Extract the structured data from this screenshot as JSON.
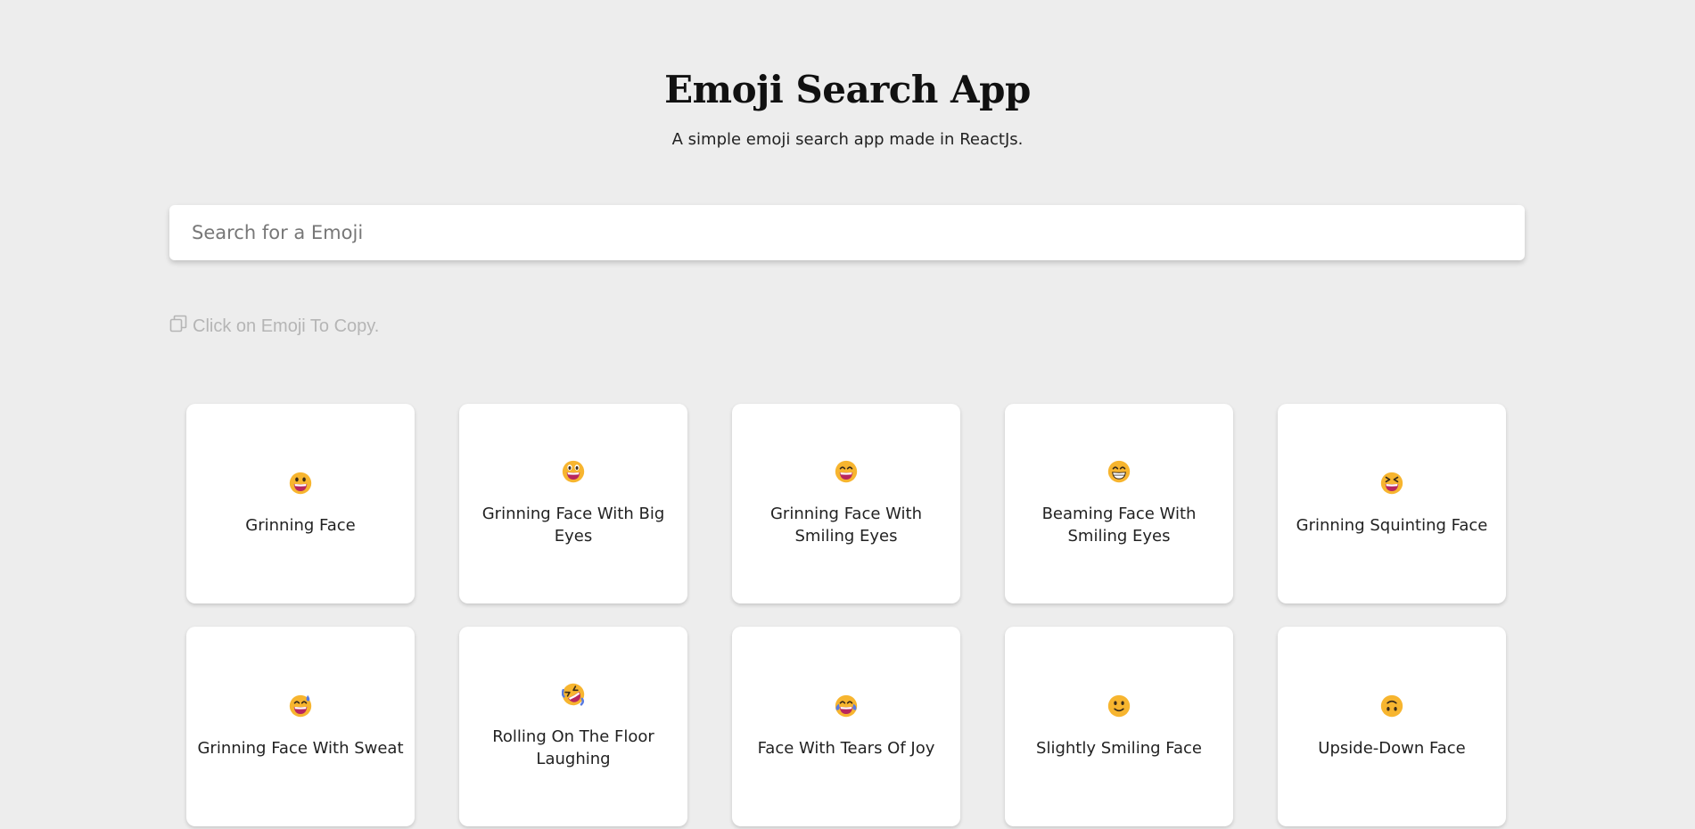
{
  "header": {
    "title": "Emoji Search App",
    "subtitle": "A simple emoji search app made in ReactJs."
  },
  "search": {
    "placeholder": "Search for a Emoji",
    "value": ""
  },
  "hint": {
    "text": "Click on Emoji To Copy.",
    "icon": "copy-icon"
  },
  "colors": {
    "background": "#ededed",
    "card": "#ffffff",
    "emoji_face": "#f7b52f",
    "emoji_mouth": "#b8265e",
    "hint_text": "#b5b5b5"
  },
  "emojis": [
    {
      "name": "Grinning Face",
      "icon": "grinning-face-icon"
    },
    {
      "name": "Grinning Face With Big Eyes",
      "icon": "grinning-face-big-eyes-icon"
    },
    {
      "name": "Grinning Face With Smiling Eyes",
      "icon": "grinning-face-smiling-eyes-icon"
    },
    {
      "name": "Beaming Face With Smiling Eyes",
      "icon": "beaming-face-icon"
    },
    {
      "name": "Grinning Squinting Face",
      "icon": "grinning-squinting-face-icon"
    },
    {
      "name": "Grinning Face With Sweat",
      "icon": "grinning-face-sweat-icon"
    },
    {
      "name": "Rolling On The Floor Laughing",
      "icon": "rolling-laughing-icon"
    },
    {
      "name": "Face With Tears Of Joy",
      "icon": "tears-of-joy-icon"
    },
    {
      "name": "Slightly Smiling Face",
      "icon": "slightly-smiling-face-icon"
    },
    {
      "name": "Upside-Down Face",
      "icon": "upside-down-face-icon"
    }
  ]
}
